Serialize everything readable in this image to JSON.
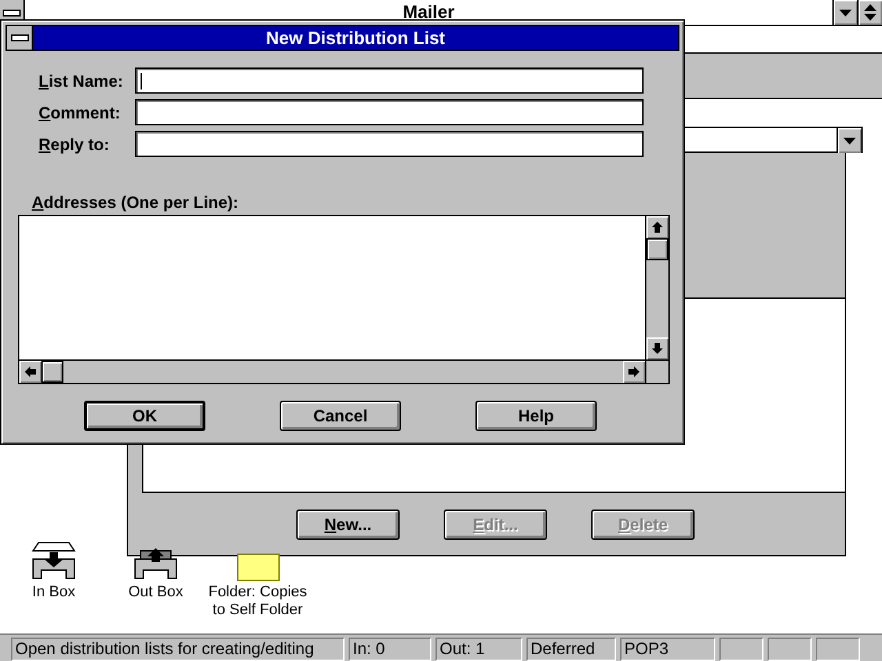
{
  "main_window": {
    "title": "Mailer"
  },
  "distribution_window": {
    "buttons": [
      {
        "label": "New...",
        "disabled": false,
        "mnemonic": true
      },
      {
        "label": "Edit...",
        "disabled": true,
        "mnemonic": true
      },
      {
        "label": "Delete",
        "disabled": true,
        "mnemonic": true
      }
    ]
  },
  "desktop_icons": [
    {
      "kind": "inbox",
      "label": "In Box"
    },
    {
      "kind": "outbox",
      "label": "Out Box"
    },
    {
      "kind": "folder",
      "label": "Folder: Copies to Self Folder"
    }
  ],
  "dialog": {
    "title": "New Distribution List",
    "fields": [
      {
        "label": "List Name:",
        "mnemonic": true,
        "focused": true
      },
      {
        "label": "Comment:",
        "mnemonic": true,
        "focused": false
      },
      {
        "label": "Reply to:",
        "mnemonic": true,
        "focused": false
      }
    ],
    "addresses_label": "Addresses (One per Line):",
    "buttons": [
      {
        "label": "OK",
        "default": true
      },
      {
        "label": "Cancel",
        "default": false
      },
      {
        "label": "Help",
        "default": false
      }
    ]
  },
  "status_bar": [
    "Open distribution lists for creating/editing",
    "In:  0",
    "Out:  1",
    "Deferred",
    "POP3"
  ]
}
